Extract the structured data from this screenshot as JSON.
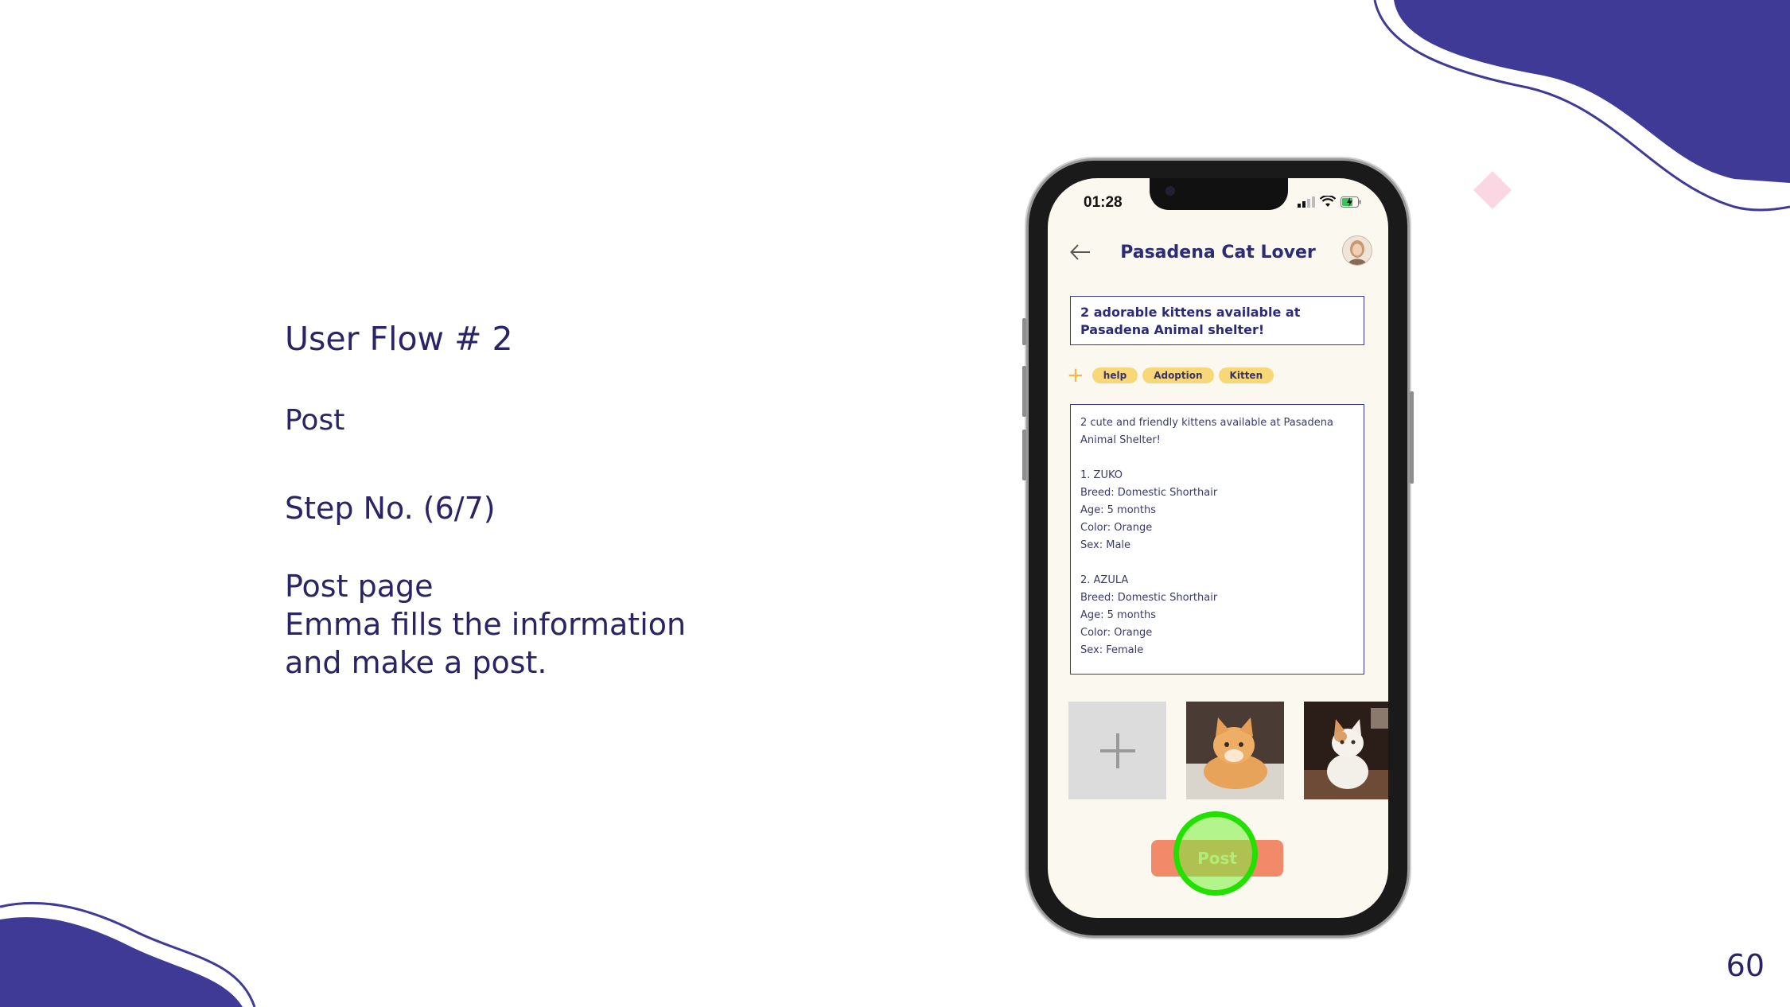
{
  "slide": {
    "title": "User Flow # 2",
    "subtitle": "Post",
    "step": "Step No. (6/7)",
    "description_lines": [
      "Post page",
      "Emma fills the information",
      "and make a post."
    ],
    "page_number": "60"
  },
  "phone": {
    "status_time": "01:28",
    "header": {
      "back_icon": "arrow-left-icon",
      "title": "Pasadena Cat Lover",
      "avatar": "user-avatar"
    },
    "post_title": "2 adorable kittens available at Pasadena Animal shelter!",
    "tags": [
      "help",
      "Adoption",
      "Kitten"
    ],
    "description_lines": [
      "2 cute and friendly kittens available at Pasadena",
      "Animal Shelter!",
      "",
      "1. ZUKO",
      "Breed: Domestic Shorthair",
      "Age: 5 months",
      "Color: Orange",
      "Sex: Male",
      "",
      "2. AZULA",
      "Breed: Domestic Shorthair",
      "Age: 5 months",
      "Color: Orange",
      "Sex: Female"
    ],
    "photos": [
      "add-photo-icon",
      "orange-kitten-photo",
      "white-kitten-photo"
    ],
    "post_button": "Post"
  },
  "colors": {
    "brand_purple": "#3f3a96",
    "accent_tag": "#f7d777",
    "post_button": "#f28a6a",
    "highlight": "#22e000"
  }
}
